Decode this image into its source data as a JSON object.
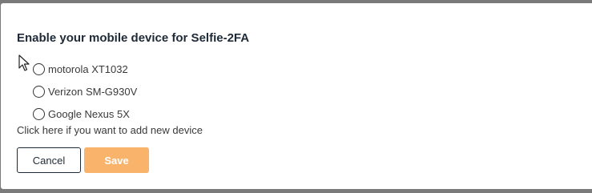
{
  "dialog": {
    "title": "Enable your mobile device for Selfie-2FA",
    "devices": [
      {
        "label": "motorola XT1032",
        "selected": false
      },
      {
        "label": "Verizon SM-G930V",
        "selected": false
      },
      {
        "label": "Google Nexus 5X",
        "selected": false
      }
    ],
    "add_device_text": "Click here if you want to add new device",
    "cancel_label": "Cancel",
    "save_label": "Save"
  },
  "colors": {
    "title": "#1f2a37",
    "save_button_bg": "#f9b36a",
    "cancel_border": "#1f2a37",
    "overlay": "#7a7a7a"
  },
  "icons": {
    "cursor": "mouse-pointer-icon"
  }
}
